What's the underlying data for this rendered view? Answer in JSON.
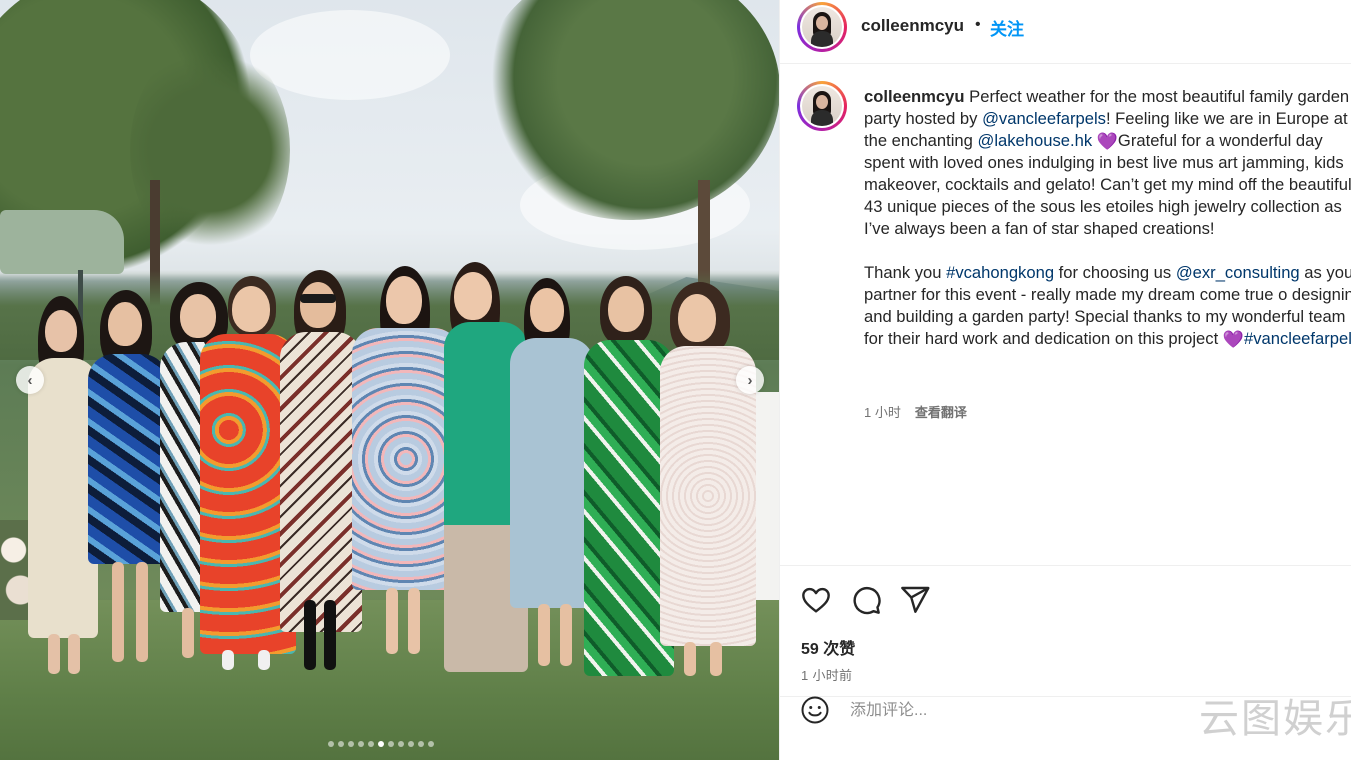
{
  "post": {
    "photo_alt": "Group photo of nine women at a garden party",
    "carousel": {
      "total": 11,
      "active_index": 5
    }
  },
  "header": {
    "username": "colleenmcyu",
    "separator": "•",
    "follow_label": "关注"
  },
  "caption": {
    "username": "colleenmcyu",
    "part1": " Perfect weather for the most beautiful family garden party hosted by ",
    "mention1": "@vancleefarpels",
    "part2": "! Feeling like we are in Europe at the enchanting ",
    "mention2": "@lakehouse.hk",
    "part3": "Grateful for a wonderful day spent with loved ones indulging in best live mus art jamming, kids makeover, cocktails and gelato! Can’t get my mind off the beautiful 43 unique pieces of the sous les etoiles high jewelry collection as I’ve always been a fan of star shaped creations!\n\nThank you ",
    "hashtag1": "#vcahongkong",
    "part4": " for choosing us ",
    "mention3": "@exr_consulting",
    "part5": " as your partner for this event - really made my dream come true o designing and building a garden party! Special thanks to my wonderful team for their hard work and dedication on this project ",
    "hashtag2": "#vancleefarpels",
    "emoji_heart": "💜"
  },
  "meta": {
    "posted_ago": "1 小时",
    "translate_label": "查看翻译"
  },
  "actions": {
    "likes": "59 次赞",
    "timestamp": "1 小时前"
  },
  "comment": {
    "placeholder": "添加评论..."
  },
  "watermark": "云图娱乐",
  "colors": {
    "accent_blue": "#0095f6",
    "link_blue": "#00376b",
    "heart_purple": "#7c6bd6"
  }
}
